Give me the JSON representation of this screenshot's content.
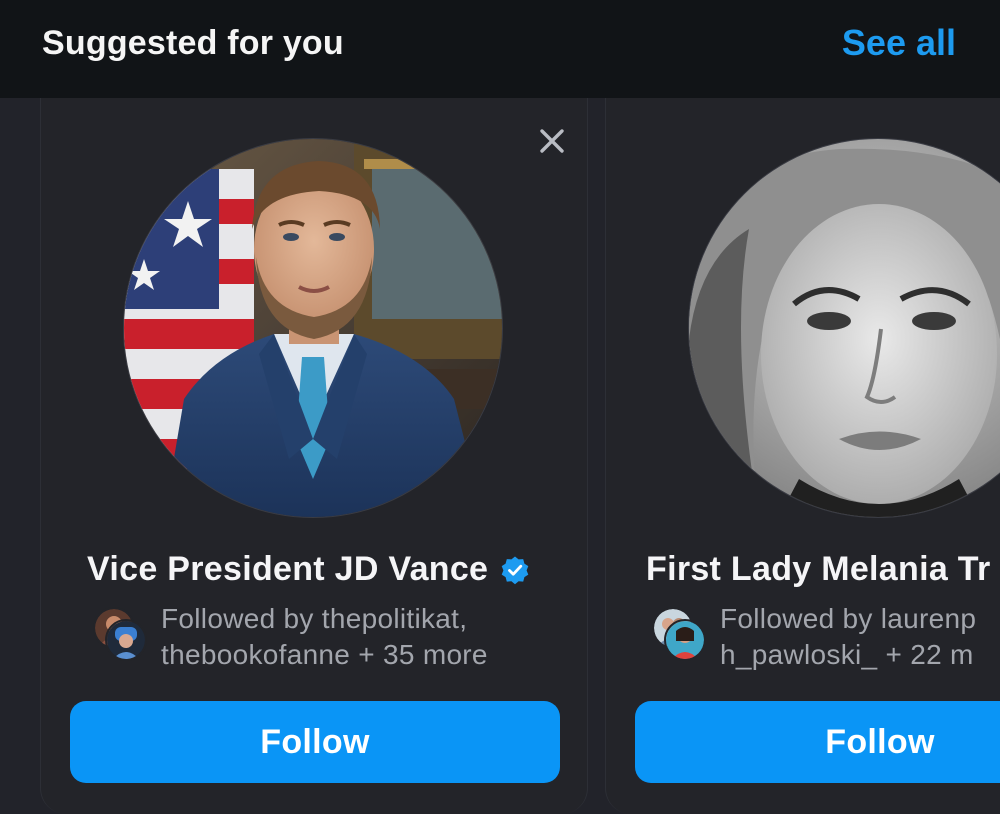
{
  "header": {
    "title": "Suggested for you",
    "see_all_label": "See all"
  },
  "colors": {
    "accent": "#1d9bf0",
    "follow_button": "#0a95f6",
    "card_background": "#232429",
    "header_background": "#111417",
    "secondary_text": "#a3a6ad"
  },
  "suggestions": [
    {
      "name": "Vice President JD Vance",
      "verified": true,
      "followed_by_line1": "Followed by thepolitikat,",
      "followed_by_line2": "thebookofanne + 35 more",
      "follow_label": "Follow",
      "dismiss_icon": "close-icon"
    },
    {
      "name": "First Lady Melania Tr",
      "followed_by_line1": "Followed by laurenp",
      "followed_by_line2": "h_pawloski_ + 22 m",
      "follow_label": "Follow"
    }
  ]
}
